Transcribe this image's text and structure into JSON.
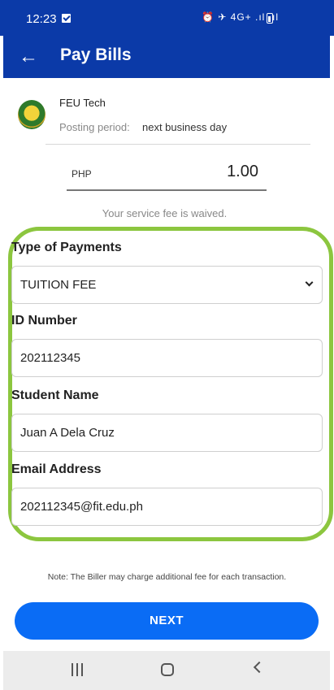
{
  "status_bar": {
    "time": "12:23",
    "icons": "⏰ ✈ 4G+ .ıl .ıl"
  },
  "header": {
    "title": "Pay Bills",
    "back_icon": "back-arrow-icon"
  },
  "biller": {
    "name": "FEU Tech",
    "posting_label": "Posting period:",
    "posting_value": "next business day"
  },
  "amount": {
    "currency": "PHP",
    "value": "1.00",
    "fee_note": "Your service fee is waived."
  },
  "form": {
    "type_label": "Type of Payments",
    "type_value": "TUITION FEE",
    "id_label": "ID Number",
    "id_value": "202112345",
    "name_label": "Student Name",
    "name_value": "Juan A Dela Cruz",
    "email_label": "Email Address",
    "email_value": "202112345@fit.edu.ph"
  },
  "note": "Note: The Biller may charge additional fee for each transaction.",
  "next_label": "NEXT",
  "colors": {
    "brand_blue": "#0b3aa8",
    "button_blue": "#0a6cf5",
    "highlight_green": "#8cc63f"
  }
}
